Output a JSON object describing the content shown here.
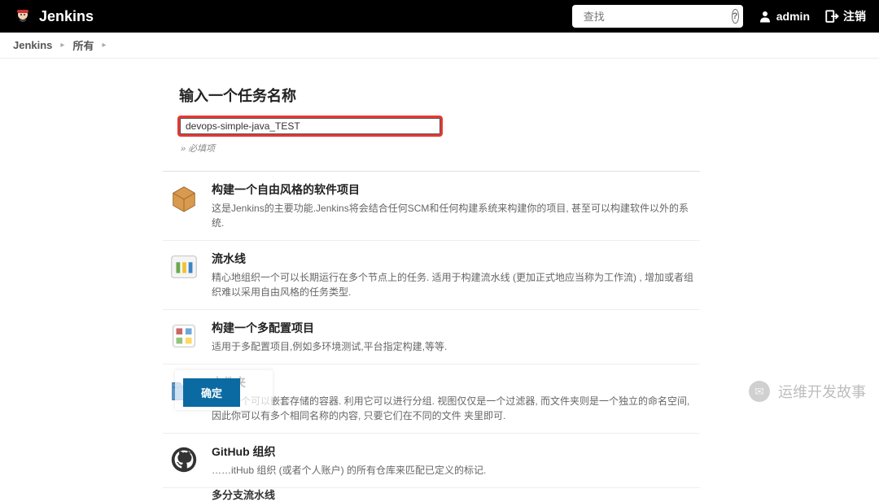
{
  "header": {
    "brand": "Jenkins",
    "search_placeholder": "查找",
    "user": "admin",
    "logout": "注销"
  },
  "breadcrumbs": {
    "root": "Jenkins",
    "page": "所有"
  },
  "form": {
    "title": "输入一个任务名称",
    "name_value": "devops-simple-java_TEST",
    "required_hint": "» 必填项"
  },
  "options": [
    {
      "title": "构建一个自由风格的软件项目",
      "desc": "这是Jenkins的主要功能.Jenkins将会结合任何SCM和任何构建系统来构建你的项目, 甚至可以构建软件以外的系统."
    },
    {
      "title": "流水线",
      "desc": "精心地组织一个可以长期运行在多个节点上的任务. 适用于构建流水线 (更加正式地应当称为工作流) , 增加或者组织难以采用自由风格的任务类型."
    },
    {
      "title": "构建一个多配置项目",
      "desc": "适用于多配置项目,例如多环境测试,平台指定构建,等等."
    },
    {
      "title": "文件夹",
      "desc": "创建一个可以嵌套存储的容器. 利用它可以进行分组.  视图仅仅是一个过滤器, 而文件夹则是一个独立的命名空间,  因此你可以有多个相同名称的内容, 只要它们在不同的文件 夹里即可."
    },
    {
      "title": "GitHub 组织",
      "desc": "……itHub 组织 (或者个人账户) 的所有仓库来匹配已定义的标记."
    }
  ],
  "multibranch": "多分支流水线",
  "footer": {
    "ok": "确定"
  },
  "watermark": "运维开发故事"
}
